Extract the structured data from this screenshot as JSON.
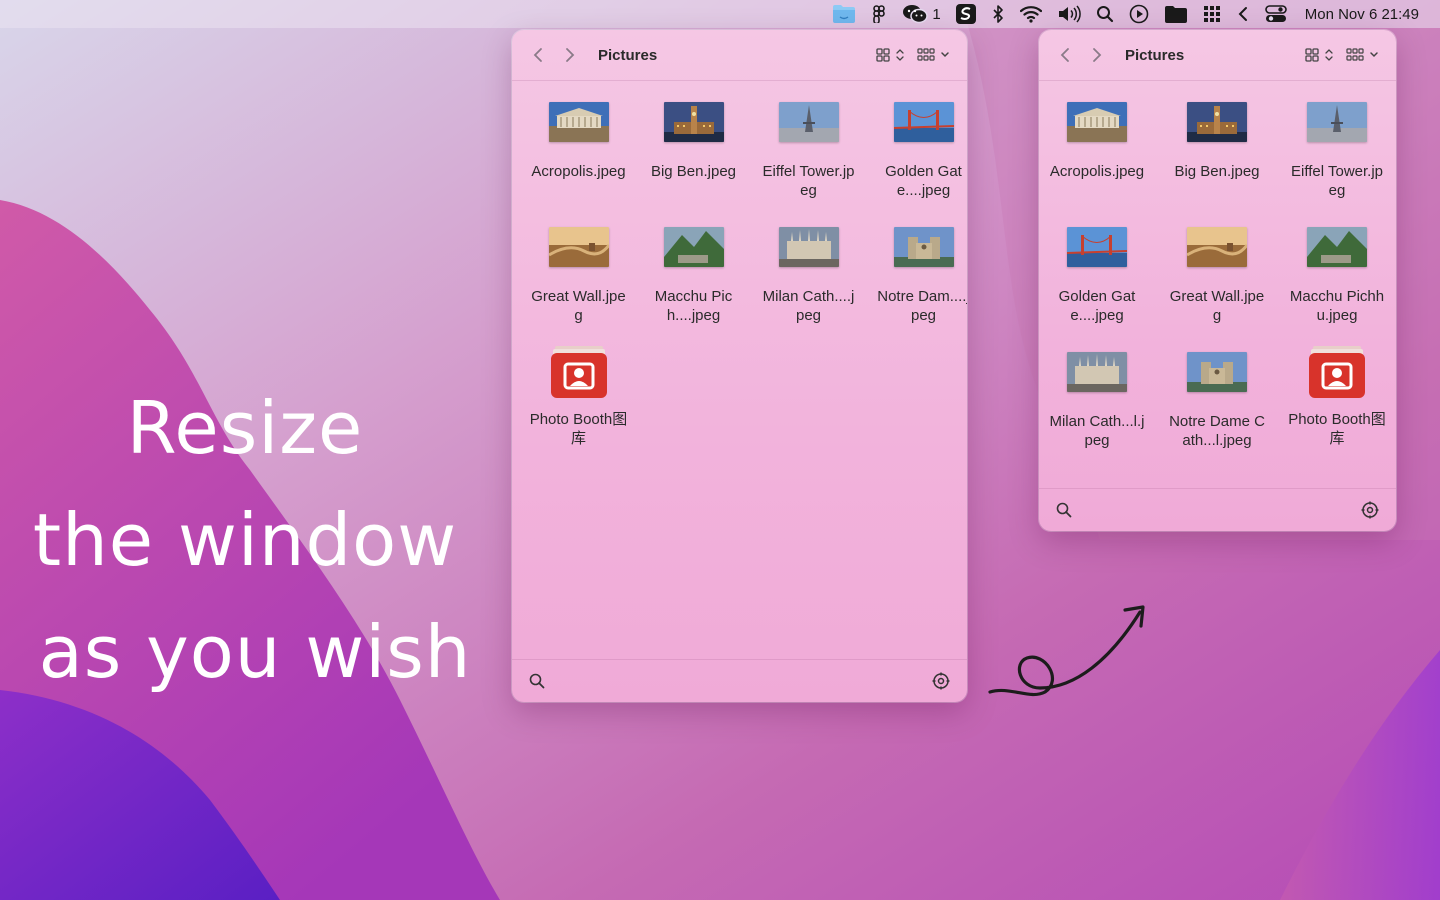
{
  "menubar": {
    "icons": [
      "finder-folder-icon",
      "figma-icon",
      "wechat-icon",
      "scrivener-icon",
      "bluetooth-icon",
      "wifi-icon",
      "volume-icon",
      "spotlight-icon",
      "play-circle-icon",
      "folder-icon",
      "grid-icon",
      "chevron-left-icon",
      "control-center-icon"
    ],
    "wechat_badge": "1",
    "clock": "Mon Nov 6  21:49"
  },
  "headline": {
    "line1": "Resize",
    "line2": "the window",
    "line3": "as you wish"
  },
  "window_large": {
    "title": "Pictures",
    "files": [
      {
        "name": "Acropolis.jpeg",
        "thumb": "acropolis"
      },
      {
        "name": "Big Ben.jpeg",
        "thumb": "bigben"
      },
      {
        "name": "Eiffel Tower.jpeg",
        "thumb": "eiffel"
      },
      {
        "name": "Golden Gate....jpeg",
        "thumb": "goldengate"
      },
      {
        "name": "Great Wall.jpeg",
        "thumb": "greatwall"
      },
      {
        "name": "Macchu Pich....jpeg",
        "thumb": "machu"
      },
      {
        "name": "Milan Cath....jpeg",
        "thumb": "milan"
      },
      {
        "name": "Notre Dam....jpeg",
        "thumb": "notredame"
      },
      {
        "name": "Photo Booth图库",
        "thumb": "photobooth"
      }
    ]
  },
  "window_small": {
    "title": "Pictures",
    "files": [
      {
        "name": "Acropolis.jpeg",
        "thumb": "acropolis"
      },
      {
        "name": "Big Ben.jpeg",
        "thumb": "bigben"
      },
      {
        "name": "Eiffel Tower.jpeg",
        "thumb": "eiffel"
      },
      {
        "name": "Golden Gate....jpeg",
        "thumb": "goldengate"
      },
      {
        "name": "Great Wall.jpeg",
        "thumb": "greatwall"
      },
      {
        "name": "Macchu Pichhu.jpeg",
        "thumb": "machu"
      },
      {
        "name": "Milan Cath...l.jpeg",
        "thumb": "milan"
      },
      {
        "name": "Notre Dame Cath...l.jpeg",
        "thumb": "notredame"
      },
      {
        "name": "Photo Booth图库",
        "thumb": "photobooth"
      }
    ]
  },
  "colors": {
    "accent": "#e0a5d3",
    "wallpaper_top": "#d8d3e8",
    "wallpaper_mid": "#c760b0",
    "wallpaper_deep": "#6a24c9",
    "photobooth_red": "#d8332b"
  }
}
